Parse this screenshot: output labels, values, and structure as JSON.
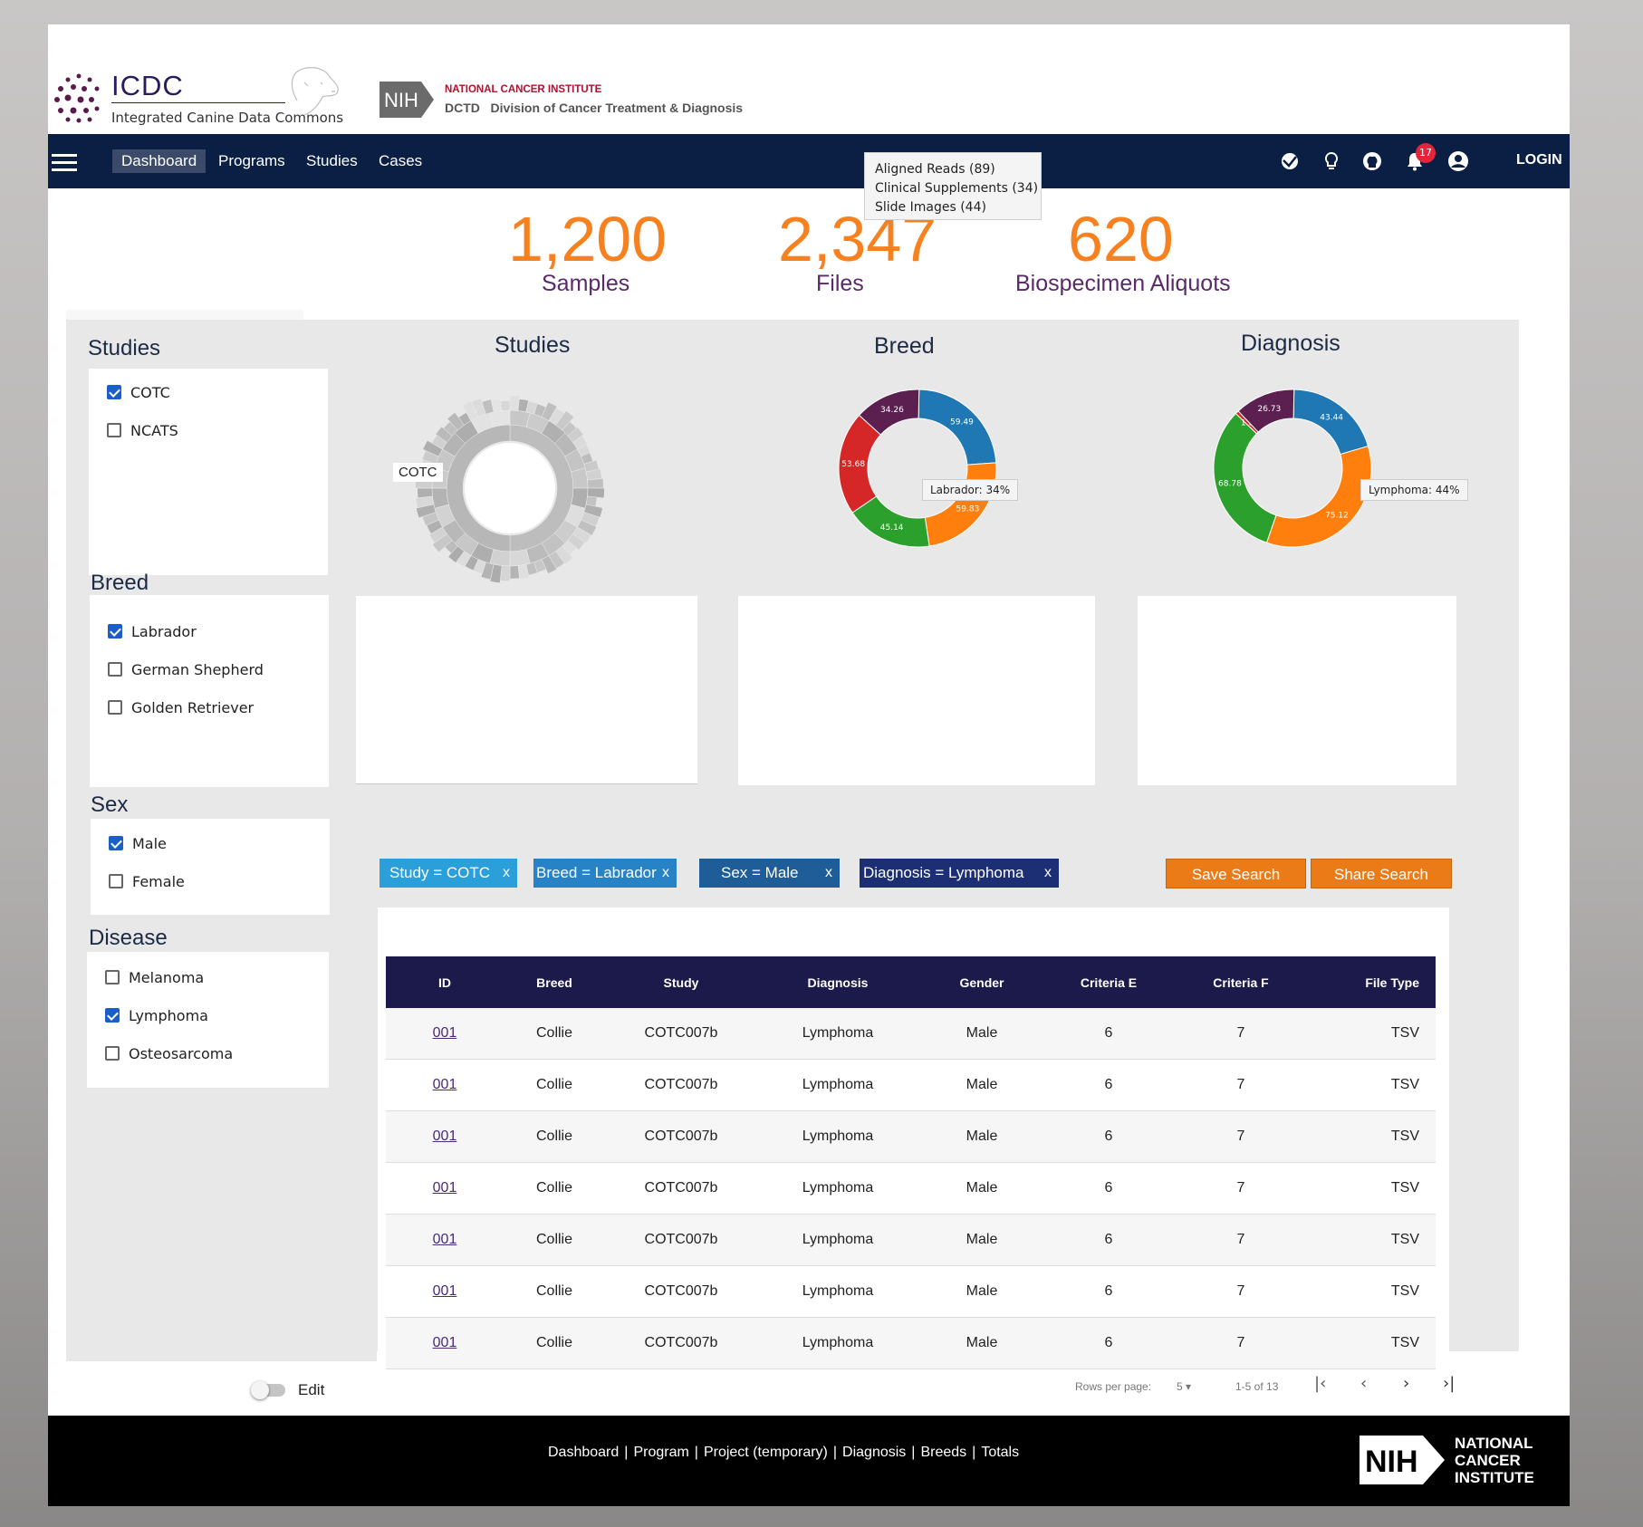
{
  "header": {
    "logo_title": "ICDC",
    "logo_subtitle": "Integrated Canine Data Commons",
    "nih_badge": "NIH",
    "nci_top": "NATIONAL CANCER INSTITUTE",
    "nci_bottom": "DCTD   Division of Cancer Treatment & Diagnosis"
  },
  "nav": {
    "items": [
      {
        "label": "Dashboard",
        "active": true
      },
      {
        "label": "Programs"
      },
      {
        "label": "Studies"
      },
      {
        "label": "Cases"
      }
    ],
    "icons": [
      "translate-icon",
      "lightbulb-icon",
      "github-icon",
      "bell-icon",
      "account-icon"
    ],
    "notification_count": "17",
    "login_label": "LOGIN"
  },
  "tooltip": {
    "lines": [
      "Aligned Reads (89)",
      "Clinical Supplements (34)",
      "Slide Images (44)"
    ]
  },
  "stats": [
    {
      "value": "1,200",
      "label": "Samples"
    },
    {
      "value": "2,347",
      "label": "Files"
    },
    {
      "value": "620",
      "label": "Biospecimen Aliquots"
    }
  ],
  "facets": {
    "studies": {
      "title": "Studies",
      "options": [
        {
          "label": "COTC",
          "checked": true
        },
        {
          "label": "NCATS",
          "checked": false
        }
      ]
    },
    "breed": {
      "title": "Breed",
      "options": [
        {
          "label": "Labrador",
          "checked": true
        },
        {
          "label": "German Shepherd",
          "checked": false
        },
        {
          "label": "Golden Retriever",
          "checked": false
        }
      ]
    },
    "sex": {
      "title": "Sex",
      "options": [
        {
          "label": "Male",
          "checked": true
        },
        {
          "label": "Female",
          "checked": false
        }
      ]
    },
    "disease": {
      "title": "Disease",
      "options": [
        {
          "label": "Melanoma",
          "checked": false
        },
        {
          "label": "Lymphoma",
          "checked": true
        },
        {
          "label": "Osteosarcoma",
          "checked": false
        }
      ]
    }
  },
  "charts": {
    "studies": {
      "title": "Studies",
      "label": "COTC"
    },
    "breed": {
      "title": "Breed",
      "tooltip": "Labrador: 34%"
    },
    "diagnosis": {
      "title": "Diagnosis",
      "tooltip": "Lymphoma: 44%"
    }
  },
  "chart_data": [
    {
      "type": "pie",
      "title": "Breed",
      "variant": "donut",
      "labels": [
        "59.49",
        "59.83",
        "45.14",
        "53.68",
        "34.26"
      ],
      "values": [
        59.49,
        59.83,
        45.14,
        53.68,
        34.26
      ],
      "colors": [
        "#1f77b4",
        "#ff7f0e",
        "#2ca02c",
        "#d62728",
        "#5b1f50"
      ]
    },
    {
      "type": "pie",
      "title": "Diagnosis",
      "variant": "donut",
      "labels": [
        "43.44",
        "75.12",
        "68.78",
        "1.5",
        "26.73"
      ],
      "values": [
        43.44,
        75.12,
        68.78,
        1.5,
        26.73
      ],
      "colors": [
        "#1f77b4",
        "#ff7f0e",
        "#2ca02c",
        "#d62728",
        "#5b1f50"
      ]
    }
  ],
  "filters": [
    {
      "label": "Study = COTC",
      "remove": "x",
      "color": "#2b9fd9"
    },
    {
      "label": "Breed = Labrador",
      "remove": "x",
      "color": "#2783c6"
    },
    {
      "label": "Sex = Male",
      "remove": "x",
      "color": "#1e5d97"
    },
    {
      "label": "Diagnosis = Lymphoma",
      "remove": "x",
      "color": "#1d2f74"
    }
  ],
  "actions": {
    "save": "Save Search",
    "share": "Share Search"
  },
  "table": {
    "columns": [
      "ID",
      "Breed",
      "Study",
      "Diagnosis",
      "Gender",
      "Criteria E",
      "Criteria F",
      "File Type"
    ],
    "rows": [
      [
        "001",
        "Collie",
        "COTC007b",
        "Lymphoma",
        "Male",
        "6",
        "7",
        "TSV"
      ],
      [
        "001",
        "Collie",
        "COTC007b",
        "Lymphoma",
        "Male",
        "6",
        "7",
        "TSV"
      ],
      [
        "001",
        "Collie",
        "COTC007b",
        "Lymphoma",
        "Male",
        "6",
        "7",
        "TSV"
      ],
      [
        "001",
        "Collie",
        "COTC007b",
        "Lymphoma",
        "Male",
        "6",
        "7",
        "TSV"
      ],
      [
        "001",
        "Collie",
        "COTC007b",
        "Lymphoma",
        "Male",
        "6",
        "7",
        "TSV"
      ],
      [
        "001",
        "Collie",
        "COTC007b",
        "Lymphoma",
        "Male",
        "6",
        "7",
        "TSV"
      ],
      [
        "001",
        "Collie",
        "COTC007b",
        "Lymphoma",
        "Male",
        "6",
        "7",
        "TSV"
      ]
    ]
  },
  "pagination": {
    "rows_per_page_label": "Rows per page:",
    "rows_per_page": "5",
    "range": "1-5 of 13"
  },
  "edit_toggle": {
    "label": "Edit"
  },
  "footer": {
    "links": [
      "Dashboard",
      "Program",
      "Project (temporary)",
      "Diagnosis",
      "Breeds",
      "Totals"
    ],
    "nih": "NIH",
    "nci_lines": [
      "NATIONAL",
      "CANCER",
      "INSTITUTE"
    ]
  },
  "colors": {
    "accent": "#f7811f",
    "nav": "#0b1f44",
    "table_header": "#1c1a4b",
    "button": "#ea7b17"
  }
}
